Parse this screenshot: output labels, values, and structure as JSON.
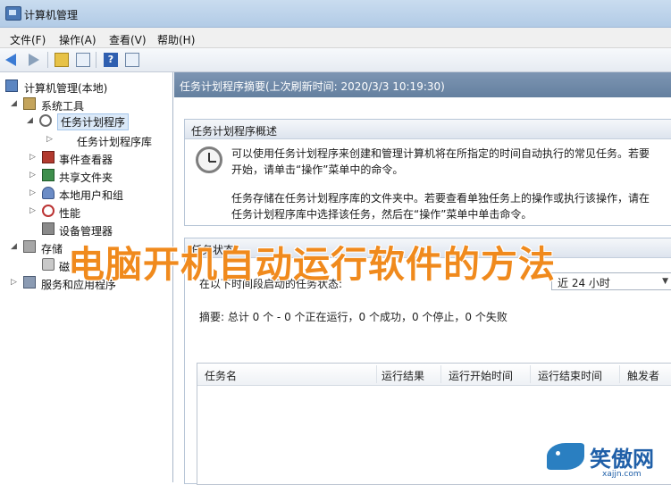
{
  "window": {
    "title": "计算机管理"
  },
  "menu": [
    "文件(F)",
    "操作(A)",
    "查看(V)",
    "帮助(H)"
  ],
  "toolbar_icons": [
    "back-arrow-icon",
    "forward-arrow-icon",
    "up-folder-icon",
    "show-hide-tree-icon",
    "help-icon",
    "properties-icon"
  ],
  "tree": {
    "root": "计算机管理(本地)",
    "system_tools": "系统工具",
    "task_scheduler": "任务计划程序",
    "task_library": "任务计划程序库",
    "event_viewer": "事件查看器",
    "shared_folders": "共享文件夹",
    "local_users": "本地用户和组",
    "performance": "性能",
    "device_manager": "设备管理器",
    "storage": "存储",
    "disk_mgmt": "磁",
    "services": "服务和应用程序"
  },
  "content": {
    "header": "任务计划程序摘要(上次刷新时间: 2020/3/3 10:19:30)",
    "overview_title": "任务计划程序概述",
    "overview_p1_line1": "可以使用任务计划程序来创建和管理计算机将在所指定的时间自动执行的常见任务。若要",
    "overview_p1_line2": "开始，请单击“操作”菜单中的命令。",
    "overview_p2_line1": "任务存储在任务计划程序库的文件夹中。若要查看单独任务上的操作或执行该操作，请在",
    "overview_p2_line2": "任务计划程序库中选择该任务，然后在“操作”菜单中单击命令。",
    "status_title": "任务状态",
    "status_label": "在以下时间段启动的任务状态:",
    "period_value": "近 24 小时",
    "summary": "摘要: 总计 0 个 - 0 个正在运行，0 个成功，0 个停止，0 个失败",
    "columns": [
      "任务名",
      "运行结果",
      "运行开始时间",
      "运行结束时间",
      "触发者"
    ]
  },
  "overlay": {
    "watermark": "电脑开机自动运行软件的方法",
    "logo_text": "笑傲网",
    "logo_site": "xajjn.com"
  },
  "colors": {
    "watermark": "#f08a1d",
    "header_bar": "#6f89a9",
    "logo": "#1f5fa8"
  }
}
